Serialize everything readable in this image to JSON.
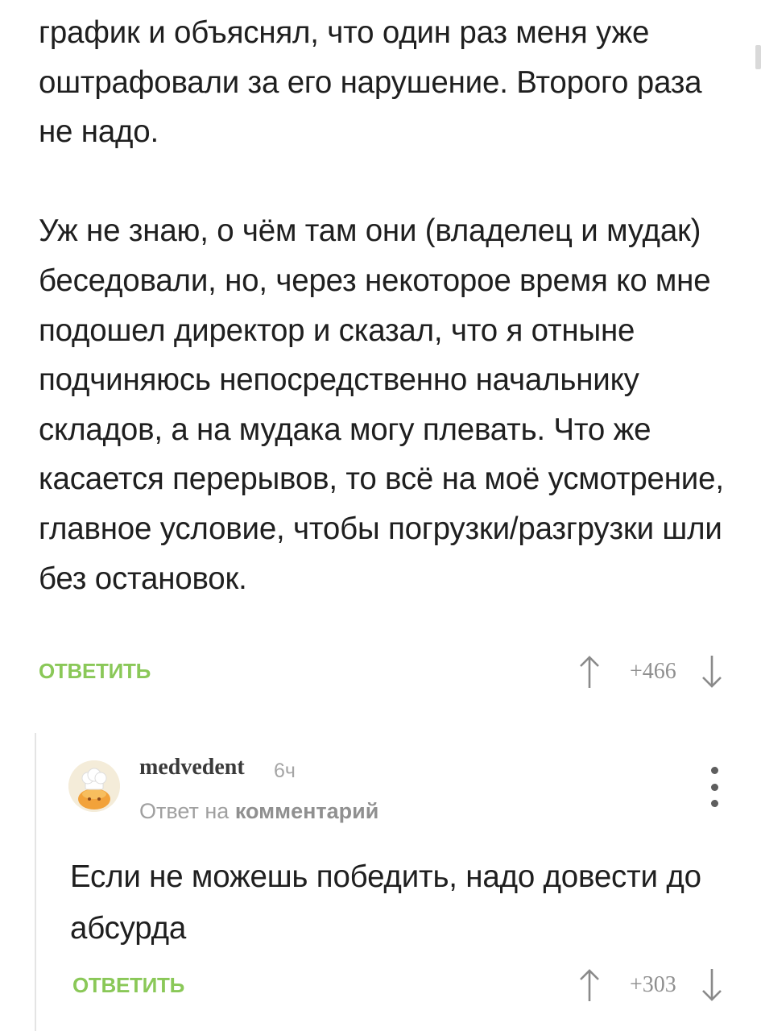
{
  "comment": {
    "paragraphs": [
      "график и объяснял, что один раз меня уже оштрафовали за его нарушение. Второго раза не надо.",
      "Уж не знаю, о чём там они (владелец и мудак) беседовали, но, через некоторое время ко мне подошел директор и сказал, что я отныне подчиняюсь непосредственно начальнику складов, а на мудака могу плевать. Что же касается перерывов, то всё на моё усмотрение, главное условие, чтобы погрузки/разгрузки шли без остановок."
    ],
    "reply_label": "ОТВЕТИТЬ",
    "rating": "+466"
  },
  "reply": {
    "author": "medvedent",
    "time": "6ч",
    "reply_to_prefix": "Ответ на",
    "reply_to_link": "комментарий",
    "text": "Если не можешь победить, надо довести до абсурда",
    "reply_label": "ОТВЕТИТЬ",
    "rating": "+303"
  },
  "colors": {
    "accent_green": "#8ac858",
    "muted_gray": "#8f8f8f",
    "text": "#1f1f1f"
  },
  "icons": {
    "upvote": "arrow-up-icon",
    "downvote": "arrow-down-icon",
    "menu": "more-vertical-icon",
    "avatar": "chef-avatar-icon"
  }
}
